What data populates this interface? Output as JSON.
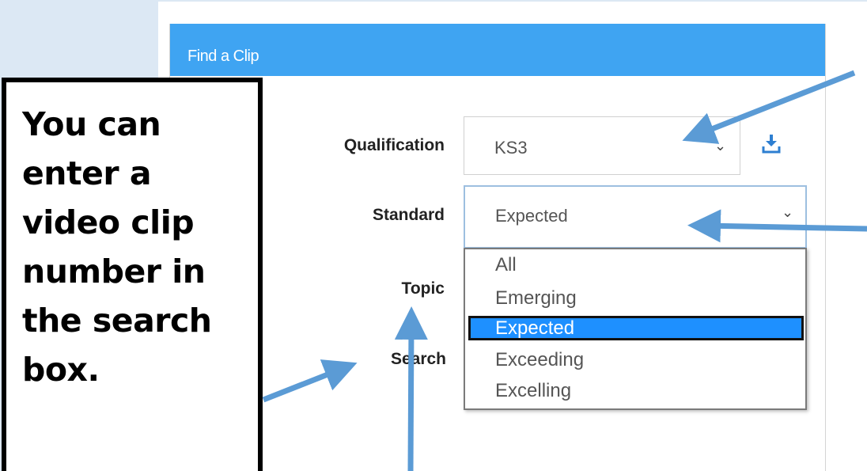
{
  "panel": {
    "title": "Find a Clip"
  },
  "form": {
    "qualification_label": "Qualification",
    "qualification_value": "KS3",
    "standard_label": "Standard",
    "standard_value": "Expected",
    "topic_label": "Topic",
    "search_label": "Search"
  },
  "standard_options": [
    "All",
    "Emerging",
    "Expected",
    "Exceeding",
    "Excelling"
  ],
  "standard_selected_index": 2,
  "callout": {
    "lines": [
      "You can",
      "enter a",
      "video clip",
      "number in",
      "the search",
      "box."
    ]
  },
  "icons": {
    "download": "download-icon",
    "chevron": "chevron-down-icon"
  },
  "colors": {
    "header": "#3fa4f2",
    "selected_option": "#1e90ff",
    "annotation_arrow": "#5b9bd5"
  }
}
